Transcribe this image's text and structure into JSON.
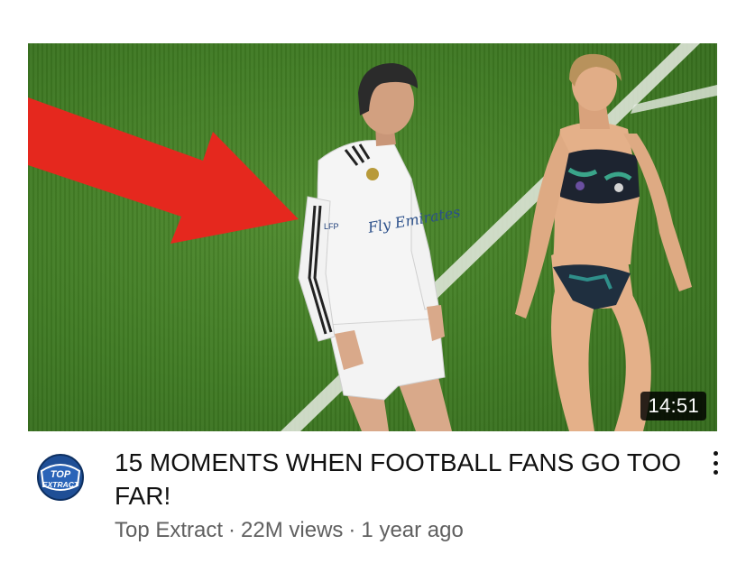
{
  "video": {
    "duration": "14:51",
    "title": "15 MOMENTS WHEN FOOTBALL FANS GO TOO FAR!",
    "channel": "Top Extract",
    "separator": "·",
    "views": "22M views",
    "age": "1 year ago"
  },
  "thumbnail": {
    "jersey_text": "Fly Emirates",
    "badge_text": "LFP"
  },
  "avatar_logo": {
    "line1": "TOP",
    "line2": "EXTRACT"
  },
  "icons": {
    "more": "more-vertical-icon",
    "arrow": "red-arrow-overlay"
  },
  "colors": {
    "arrow": "#e5281e",
    "title": "#111111",
    "meta": "#606060",
    "duration_bg": "#000000",
    "avatar_blue": "#2a64b8"
  }
}
